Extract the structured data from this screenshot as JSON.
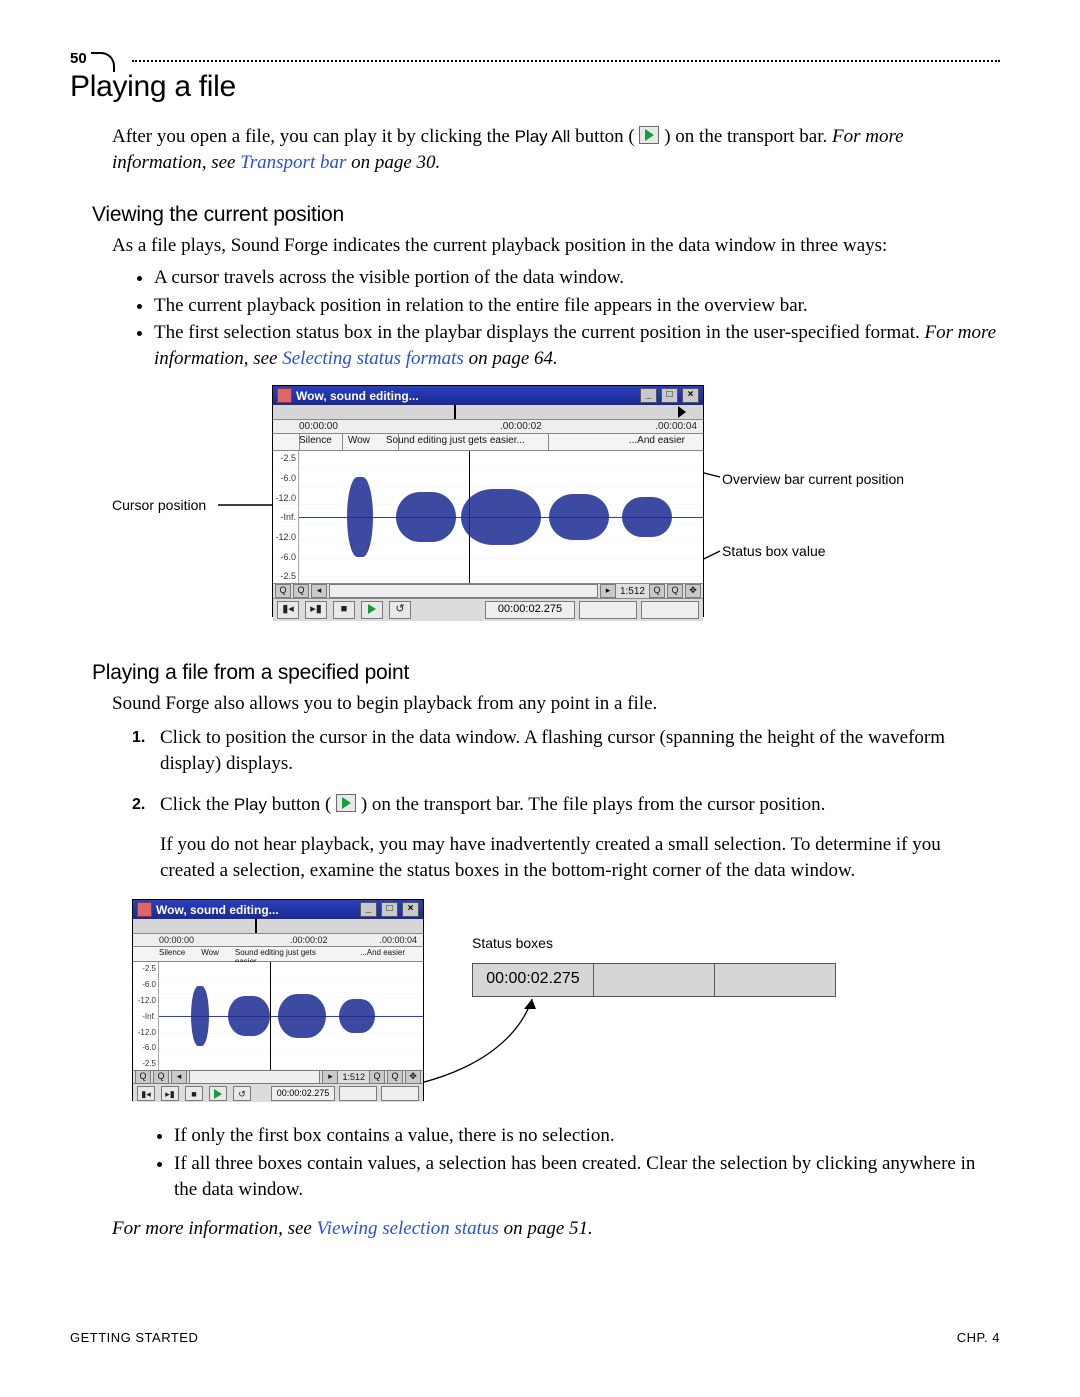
{
  "page_number": "50",
  "h1": "Playing a file",
  "intro_1": "After you open a file, you can play it by clicking the ",
  "play_all_label": "Play All",
  "intro_2": " button ( ",
  "intro_3": " ) on the transport bar. ",
  "intro_xref_lead": "For more information, see ",
  "intro_xref_link": "Transport bar",
  "intro_xref_tail": " on page 30.",
  "h2a": "Viewing the current position",
  "p_view": "As a file plays, Sound Forge indicates the current playback position in the data window in three ways:",
  "bullets_a": {
    "b1": "A cursor travels across the visible portion of the data window.",
    "b2": "The current playback position in relation to the entire file appears in the overview bar.",
    "b3_head": "The first selection status box in the playbar displays the current position in the user-specified format. ",
    "b3_xref_lead": "For more information, see ",
    "b3_xref_link": "Selecting status formats",
    "b3_xref_tail": " on page 64."
  },
  "fig1": {
    "title": "Wow, sound editing...",
    "ruler": {
      "r1": "00:00:00",
      "r2": ".00:00:02",
      "r3": ".00:00:04"
    },
    "markers": {
      "m1": "Silence",
      "m2": "Wow",
      "m3": "Sound editing just gets easier...",
      "m4": "...And easier"
    },
    "db": {
      "d1": "-2.5",
      "d2": "-6.0",
      "d3": "-12.0",
      "d4": "-Inf.",
      "d5": "-12.0",
      "d6": "-6.0",
      "d7": "-2.5"
    },
    "zoom": "1:512",
    "status_time": "00:00:02.275",
    "callout_cursor": "Cursor position",
    "callout_overview": "Overview bar current position",
    "callout_statusbox": "Status box value"
  },
  "h2b": "Playing a file from a specified point",
  "p_spec": "Sound Forge also allows you to begin playback from any point in a file.",
  "steps": {
    "s1": "Click to position the cursor in the data window. A flashing cursor (spanning the height of the waveform display) displays.",
    "s2_a": "Click the ",
    "s2_play": "Play",
    "s2_b": " button ( ",
    "s2_c": " ) on the transport bar. The file plays from the cursor position.",
    "s2_extra": "If you do not hear playback, you may have inadvertently created a small selection. To determine if you created a selection, examine the status boxes in the bottom-right corner of the data window."
  },
  "fig2": {
    "callout_status": "Status boxes",
    "status_big": "00:00:02.275"
  },
  "bullets_b": {
    "b1": "If only the first box contains a value, there is no selection.",
    "b2": "If all three boxes contain values, a selection has been created. Clear the selection by clicking anywhere in the data window."
  },
  "closing_xref_lead": "For more information, see ",
  "closing_xref_link": "Viewing selection status",
  "closing_xref_tail": " on page 51.",
  "footer_left": "GETTING STARTED",
  "footer_right": "CHP. 4"
}
